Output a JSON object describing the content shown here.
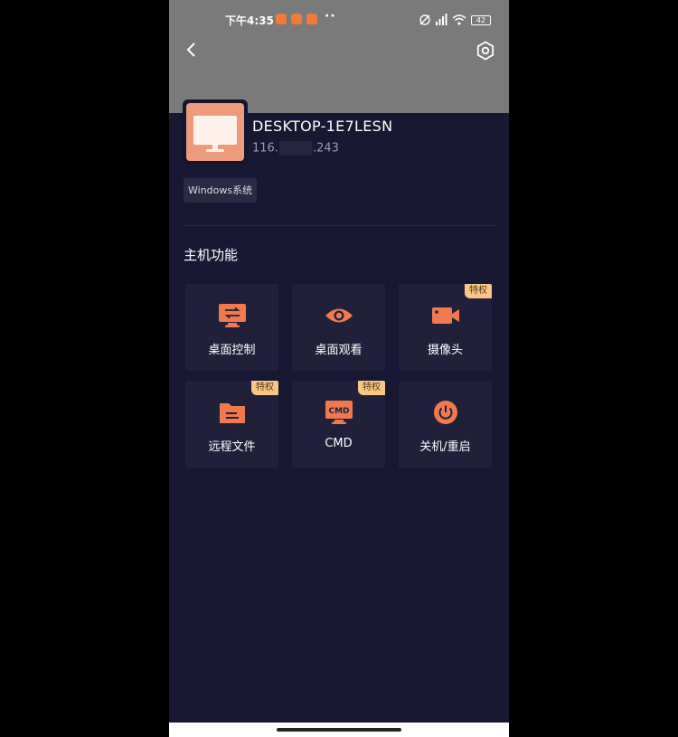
{
  "status_bar": {
    "time": "下午4:35",
    "battery": "42"
  },
  "device": {
    "name": "DESKTOP-1E7LESN",
    "ip_prefix": "116.",
    "ip_suffix": ".243",
    "os_tag": "Windows系统"
  },
  "section_title": "主机功能",
  "functions": [
    {
      "label": "桌面控制",
      "icon": "desktop-control-icon",
      "badge": ""
    },
    {
      "label": "桌面观看",
      "icon": "eye-icon",
      "badge": ""
    },
    {
      "label": "摄像头",
      "icon": "camera-icon",
      "badge": "特权"
    },
    {
      "label": "远程文件",
      "icon": "folder-icon",
      "badge": "特权"
    },
    {
      "label": "CMD",
      "icon": "cmd-icon",
      "badge": "特权",
      "icon_text": "CMD"
    },
    {
      "label": "关机/重启",
      "icon": "power-icon",
      "badge": ""
    }
  ],
  "colors": {
    "accent": "#f07a4e",
    "background": "#181834",
    "tile": "#20203a",
    "badge": "#f8c685"
  }
}
